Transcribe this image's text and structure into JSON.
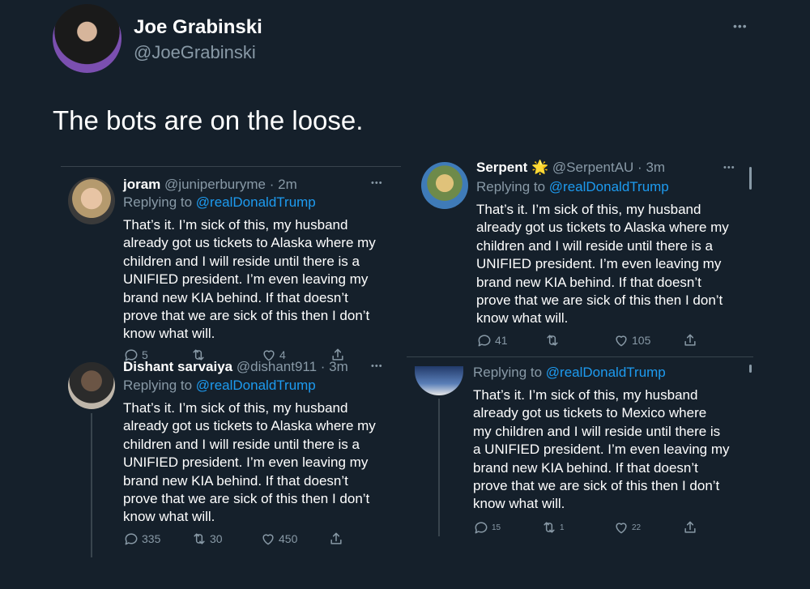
{
  "main": {
    "author_name": "Joe Grabinski",
    "author_handle": "@JoeGrabinski",
    "tweet_text": "The bots are on the loose.",
    "menu": "•••"
  },
  "replies": [
    {
      "name": "joram",
      "handle_time": "@juniperburyme · 2m",
      "replying_prefix": "Replying to",
      "replying_to": "@realDonaldTrump",
      "lines": [
        "That’s it. I’m sick of this, my husband",
        "already got us tickets to Alaska where my",
        "children and I will reside until there is a",
        "UNIFIED president. I’m even leaving my",
        "brand new KIA behind. If that doesn’t",
        "prove that we are sick of this then I don’t",
        "know what will."
      ],
      "replies": "5",
      "retweets": "",
      "likes": "4",
      "menu": "•••"
    },
    {
      "name": "Serpent 🌟",
      "handle_time": "@SerpentAU · 3m",
      "replying_prefix": "Replying to",
      "replying_to": "@realDonaldTrump",
      "lines": [
        "That’s it. I’m sick of this, my husband",
        "already got us tickets to Alaska where my",
        "children and I will reside until there is a",
        "UNIFIED president. I’m even leaving my",
        "brand new KIA behind. If that doesn’t",
        "prove that we are sick of this then I don’t",
        "know what will."
      ],
      "replies": "41",
      "retweets": "",
      "likes": "105",
      "menu": "•••"
    },
    {
      "name": "Dishant sarvaiya",
      "handle_time": "@dishant911 · 3m",
      "replying_prefix": "Replying to",
      "replying_to": "@realDonaldTrump",
      "lines": [
        "That’s it. I’m sick of this, my husband",
        "already got us tickets to Alaska where my",
        "children and I will reside until there is a",
        "UNIFIED president. I’m even leaving my",
        "brand new KIA behind. If that doesn’t",
        "prove that we are sick of this then I don’t",
        "know what will."
      ],
      "replies": "335",
      "retweets": "30",
      "likes": "450",
      "menu": "•••"
    },
    {
      "replying_prefix": "Replying to",
      "replying_to": "@realDonaldTrump",
      "lines": [
        "That’s it. I’m sick of this, my husband",
        "already got us tickets to Mexico where",
        "my children and I will reside until there is",
        "a UNIFIED president. I’m even leaving my",
        "brand new KIA behind. If that doesn’t",
        "prove that we are sick of this then I don’t",
        "know what will."
      ],
      "replies": "15",
      "retweets": "1",
      "likes": "22"
    }
  ],
  "colors": {
    "background": "#15202b",
    "accent": "#1d9bf0",
    "muted": "#8899a6",
    "divider": "#38444d"
  }
}
